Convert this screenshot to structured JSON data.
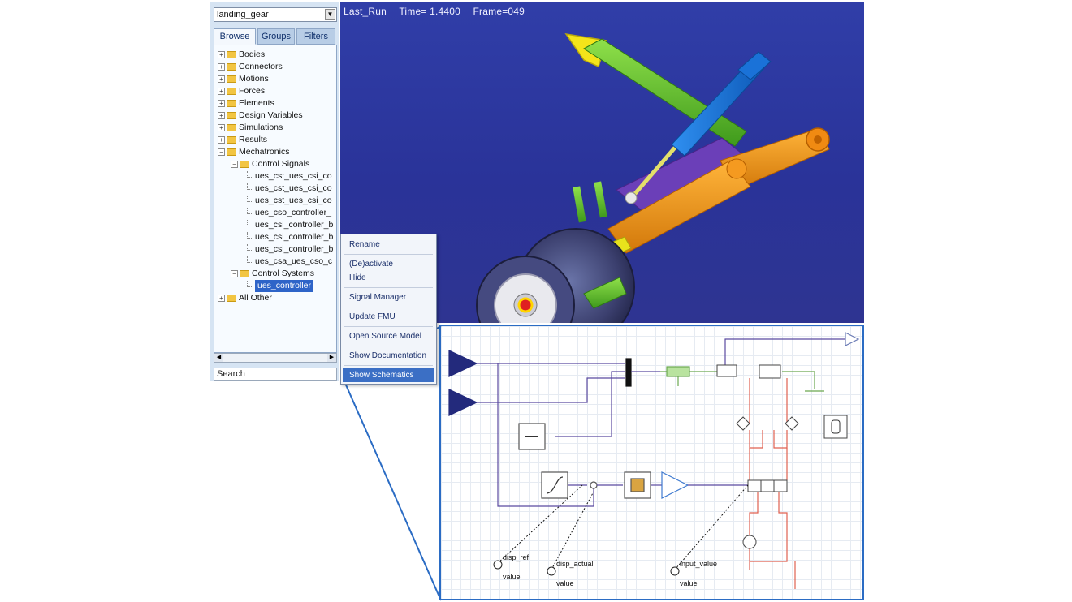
{
  "browser": {
    "model_select": "landing_gear",
    "tabs": [
      "Browse",
      "Groups",
      "Filters"
    ],
    "tree": {
      "bodies": "Bodies",
      "connectors": "Connectors",
      "motions": "Motions",
      "forces": "Forces",
      "elements": "Elements",
      "design_variables": "Design Variables",
      "simulations": "Simulations",
      "results": "Results",
      "mechatronics": "Mechatronics",
      "control_signals": "Control Signals",
      "signals": [
        "ues_cst_ues_csi_co",
        "ues_cst_ues_csi_co",
        "ues_cst_ues_csi_co",
        "ues_cso_controller_",
        "ues_csi_controller_b",
        "ues_csi_controller_b",
        "ues_csi_controller_b",
        "ues_csa_ues_cso_c"
      ],
      "control_systems": "Control Systems",
      "ues_controller": "ues_controller",
      "all_other": "All Other"
    },
    "search_label": "Search"
  },
  "viewport": {
    "run_name": "Last_Run",
    "time_text": "Time= 1.4400",
    "frame_text": "Frame=049"
  },
  "context_menu": {
    "items": [
      "Rename",
      "(De)activate",
      "Hide",
      "Signal Manager",
      "Update FMU",
      "Open Source Model",
      "Show Documentation",
      "Show Schematics"
    ],
    "highlighted": "Show Schematics"
  },
  "schematic": {
    "ports": [
      {
        "name": "disp_ref",
        "value": "value"
      },
      {
        "name": "disp_actual",
        "value": "value"
      },
      {
        "name": "input_value",
        "value": "value"
      }
    ]
  },
  "colors": {
    "viewport_bg": "#2e3a9e",
    "menu_highlight": "#3b6fc5",
    "schematic_border": "#2b6cc4",
    "signal_wire": "#5a4aa0",
    "hydraulic_wire": "#e06050",
    "mechanical_wire": "#6aa84f"
  }
}
